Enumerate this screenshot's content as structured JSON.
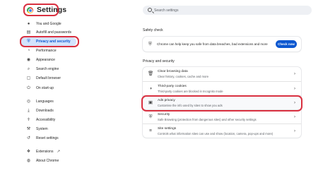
{
  "app": {
    "title": "Settings"
  },
  "search": {
    "placeholder": "Search settings"
  },
  "sidebar": {
    "items": [
      {
        "label": "You and Google",
        "icon": "person-icon",
        "active": false
      },
      {
        "label": "Autofill and passwords",
        "icon": "document-icon",
        "active": false
      },
      {
        "label": "Privacy and security",
        "icon": "shield-icon",
        "active": true
      },
      {
        "label": "Performance",
        "icon": "speedometer-icon",
        "active": false
      },
      {
        "label": "Appearance",
        "icon": "palette-icon",
        "active": false
      },
      {
        "label": "Search engine",
        "icon": "search-icon",
        "active": false
      },
      {
        "label": "Default browser",
        "icon": "browser-icon",
        "active": false
      },
      {
        "label": "On start-up",
        "icon": "power-icon",
        "active": false
      },
      {
        "label": "Languages",
        "icon": "globe-icon",
        "active": false
      },
      {
        "label": "Downloads",
        "icon": "download-icon",
        "active": false
      },
      {
        "label": "Accessibility",
        "icon": "accessibility-icon",
        "active": false
      },
      {
        "label": "System",
        "icon": "wrench-icon",
        "active": false
      },
      {
        "label": "Reset settings",
        "icon": "reset-icon",
        "active": false
      },
      {
        "label": "Extensions",
        "icon": "puzzle-icon",
        "active": false
      },
      {
        "label": "About Chrome",
        "icon": "chrome-icon",
        "active": false
      }
    ]
  },
  "safety_check": {
    "heading": "Safety check",
    "text": "Chrome can help keep you safe from data breaches, bad extensions and more",
    "button": "Check now",
    "icon": "shield-check-icon"
  },
  "privacy": {
    "heading": "Privacy and security",
    "rows": [
      {
        "title": "Clear browsing data",
        "desc": "Clear history, cookies, cache and more",
        "icon": "trash-icon"
      },
      {
        "title": "Third-party cookies",
        "desc": "Third-party cookies are blocked in Incognito mode",
        "icon": "cookie-icon"
      },
      {
        "title": "Ads privacy",
        "desc": "Customise the info used by sites to show you ads",
        "icon": "ads-icon"
      },
      {
        "title": "Security",
        "desc": "Safe Browsing (protection from dangerous sites) and other security settings",
        "icon": "shield-icon"
      },
      {
        "title": "Site settings",
        "desc": "Controls what information sites can use and show (location, camera, pop-ups and more)",
        "icon": "sliders-icon"
      }
    ]
  },
  "colors": {
    "accent": "#0b57d0",
    "highlight_outline": "#d93040",
    "active_nav_bg": "#d3e3fd"
  }
}
